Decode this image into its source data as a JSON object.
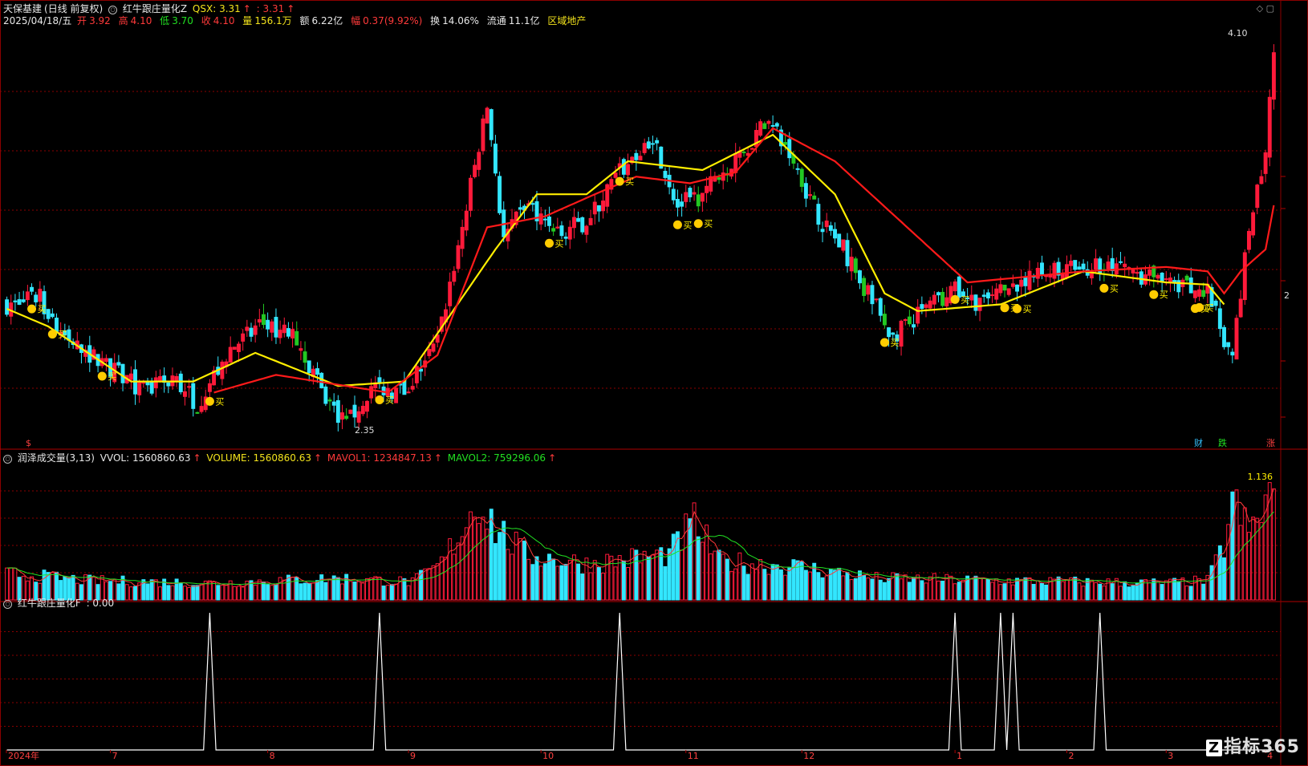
{
  "header": {
    "stock": "天保基建",
    "period": "(日线 前复权)",
    "indicator_name": "红牛跟庄量化Z",
    "qsx_label": "QSX: 3.31",
    "qsx_arrow": "↑",
    "qsx_val2": ": 3.31",
    "date": "2025/04/18/五",
    "open_label": "开",
    "open": "3.92",
    "high_label": "高",
    "high": "4.10",
    "low_label": "低",
    "low": "3.70",
    "close_label": "收",
    "close": "4.10",
    "vol_label": "量",
    "vol": "156.1万",
    "amt_label": "额",
    "amt": "6.22亿",
    "chg_label": "幅",
    "chg": "0.37(9.92%)",
    "turnover_label": "换",
    "turnover": "14.06%",
    "float_label": "流通",
    "float": "11.1亿",
    "sector": "区域地产"
  },
  "volume_panel": {
    "title": "润泽成交量(3,13)",
    "vvol": "VVOL: 1560860.63",
    "volume": "VOLUME: 1560860.63",
    "mavol1": "MAVOL1: 1234847.13",
    "mavol2": "MAVOL2: 759296.06",
    "arrow": "↑",
    "max_label": "1.136"
  },
  "f_panel": {
    "title": "红牛跟庄量化F",
    "value": ": 0.00"
  },
  "price_labels": {
    "high": "4.10",
    "low": "2.35",
    "right_tick": "2"
  },
  "x_axis_labels": [
    "2024年",
    "7",
    "8",
    "9",
    "10",
    "11",
    "12",
    "1",
    "2",
    "3",
    "4"
  ],
  "markers": {
    "buy": "买",
    "s_mark": "$",
    "cai": "财",
    "die": "跌",
    "zhang": "涨"
  },
  "watermark": {
    "logo": "Z",
    "text": "指标365"
  },
  "colors": {
    "up": "#ff1a3a",
    "down": "#33e6ff",
    "down_alt": "#22c822",
    "ma_yellow": "#ffee00",
    "ma_red": "#ff1a1a",
    "grid": "#8b0000",
    "mavol1": "#ff3a3a",
    "mavol2": "#22e022"
  },
  "chart_data": {
    "type": "candlestick",
    "title": "天保基建 (日线 前复权)",
    "ylim": [
      2.3,
      4.15
    ],
    "anchor_points": [
      {
        "x": 0,
        "close": 2.95
      },
      {
        "x": 8,
        "close": 2.98
      },
      {
        "x": 14,
        "close": 2.78
      },
      {
        "x": 20,
        "close": 2.72
      },
      {
        "x": 28,
        "close": 2.62
      },
      {
        "x": 34,
        "close": 2.55
      },
      {
        "x": 40,
        "close": 2.62
      },
      {
        "x": 46,
        "close": 2.5
      },
      {
        "x": 54,
        "close": 2.75
      },
      {
        "x": 62,
        "close": 2.86
      },
      {
        "x": 70,
        "close": 2.8
      },
      {
        "x": 76,
        "close": 2.55
      },
      {
        "x": 82,
        "close": 2.4
      },
      {
        "x": 88,
        "close": 2.58
      },
      {
        "x": 96,
        "close": 2.55
      },
      {
        "x": 104,
        "close": 2.78
      },
      {
        "x": 110,
        "close": 3.3
      },
      {
        "x": 116,
        "close": 3.85
      },
      {
        "x": 120,
        "close": 3.25
      },
      {
        "x": 126,
        "close": 3.4
      },
      {
        "x": 134,
        "close": 3.28
      },
      {
        "x": 140,
        "close": 3.33
      },
      {
        "x": 148,
        "close": 3.55
      },
      {
        "x": 156,
        "close": 3.72
      },
      {
        "x": 162,
        "close": 3.4
      },
      {
        "x": 168,
        "close": 3.45
      },
      {
        "x": 176,
        "close": 3.62
      },
      {
        "x": 184,
        "close": 3.78
      },
      {
        "x": 190,
        "close": 3.6
      },
      {
        "x": 196,
        "close": 3.35
      },
      {
        "x": 202,
        "close": 3.2
      },
      {
        "x": 208,
        "close": 3.0
      },
      {
        "x": 214,
        "close": 2.8
      },
      {
        "x": 220,
        "close": 2.9
      },
      {
        "x": 228,
        "close": 3.02
      },
      {
        "x": 236,
        "close": 2.95
      },
      {
        "x": 244,
        "close": 3.05
      },
      {
        "x": 252,
        "close": 3.1
      },
      {
        "x": 262,
        "close": 3.12
      },
      {
        "x": 272,
        "close": 3.1
      },
      {
        "x": 280,
        "close": 3.04
      },
      {
        "x": 290,
        "close": 3.0
      },
      {
        "x": 296,
        "close": 2.7
      },
      {
        "x": 300,
        "close": 3.3
      },
      {
        "x": 304,
        "close": 3.6
      },
      {
        "x": 306,
        "close": 4.1
      }
    ],
    "n_bars": 307,
    "ma_yellow_anchor": [
      {
        "x": 0,
        "v": 2.93
      },
      {
        "x": 10,
        "v": 2.85
      },
      {
        "x": 30,
        "v": 2.6
      },
      {
        "x": 45,
        "v": 2.6
      },
      {
        "x": 60,
        "v": 2.73
      },
      {
        "x": 80,
        "v": 2.58
      },
      {
        "x": 96,
        "v": 2.6
      },
      {
        "x": 118,
        "v": 3.2
      },
      {
        "x": 128,
        "v": 3.45
      },
      {
        "x": 140,
        "v": 3.45
      },
      {
        "x": 150,
        "v": 3.6
      },
      {
        "x": 168,
        "v": 3.56
      },
      {
        "x": 185,
        "v": 3.72
      },
      {
        "x": 200,
        "v": 3.45
      },
      {
        "x": 212,
        "v": 3.0
      },
      {
        "x": 220,
        "v": 2.92
      },
      {
        "x": 240,
        "v": 2.95
      },
      {
        "x": 260,
        "v": 3.1
      },
      {
        "x": 280,
        "v": 3.05
      },
      {
        "x": 290,
        "v": 3.04
      },
      {
        "x": 294,
        "v": 2.95
      }
    ],
    "ma_red_anchor": [
      {
        "x": 50,
        "v": 2.55
      },
      {
        "x": 65,
        "v": 2.63
      },
      {
        "x": 92,
        "v": 2.55
      },
      {
        "x": 104,
        "v": 2.72
      },
      {
        "x": 116,
        "v": 3.3
      },
      {
        "x": 130,
        "v": 3.35
      },
      {
        "x": 142,
        "v": 3.45
      },
      {
        "x": 152,
        "v": 3.53
      },
      {
        "x": 165,
        "v": 3.5
      },
      {
        "x": 176,
        "v": 3.55
      },
      {
        "x": 185,
        "v": 3.75
      },
      {
        "x": 200,
        "v": 3.6
      },
      {
        "x": 232,
        "v": 3.05
      },
      {
        "x": 260,
        "v": 3.1
      },
      {
        "x": 280,
        "v": 3.12
      },
      {
        "x": 290,
        "v": 3.1
      },
      {
        "x": 294,
        "v": 3.0
      },
      {
        "x": 298,
        "v": 3.1
      },
      {
        "x": 304,
        "v": 3.2
      },
      {
        "x": 306,
        "v": 3.4
      }
    ],
    "buy_signals": [
      6,
      11,
      23,
      49,
      90,
      131,
      148,
      162,
      167,
      212,
      229,
      241,
      244,
      265,
      277,
      287,
      288
    ],
    "volume_anchor": [
      {
        "x": 0,
        "v": 0.22
      },
      {
        "x": 20,
        "v": 0.16
      },
      {
        "x": 50,
        "v": 0.14
      },
      {
        "x": 80,
        "v": 0.18
      },
      {
        "x": 98,
        "v": 0.15
      },
      {
        "x": 105,
        "v": 0.3
      },
      {
        "x": 110,
        "v": 0.6
      },
      {
        "x": 114,
        "v": 0.85
      },
      {
        "x": 118,
        "v": 0.6
      },
      {
        "x": 125,
        "v": 0.38
      },
      {
        "x": 140,
        "v": 0.3
      },
      {
        "x": 160,
        "v": 0.38
      },
      {
        "x": 166,
        "v": 0.65
      },
      {
        "x": 172,
        "v": 0.32
      },
      {
        "x": 190,
        "v": 0.28
      },
      {
        "x": 210,
        "v": 0.18
      },
      {
        "x": 240,
        "v": 0.16
      },
      {
        "x": 280,
        "v": 0.14
      },
      {
        "x": 290,
        "v": 0.16
      },
      {
        "x": 294,
        "v": 0.45
      },
      {
        "x": 296,
        "v": 0.82
      },
      {
        "x": 300,
        "v": 0.55
      },
      {
        "x": 304,
        "v": 0.8
      },
      {
        "x": 306,
        "v": 0.95
      }
    ],
    "f_spikes": [
      49,
      90,
      148,
      229,
      240,
      243,
      264
    ]
  }
}
